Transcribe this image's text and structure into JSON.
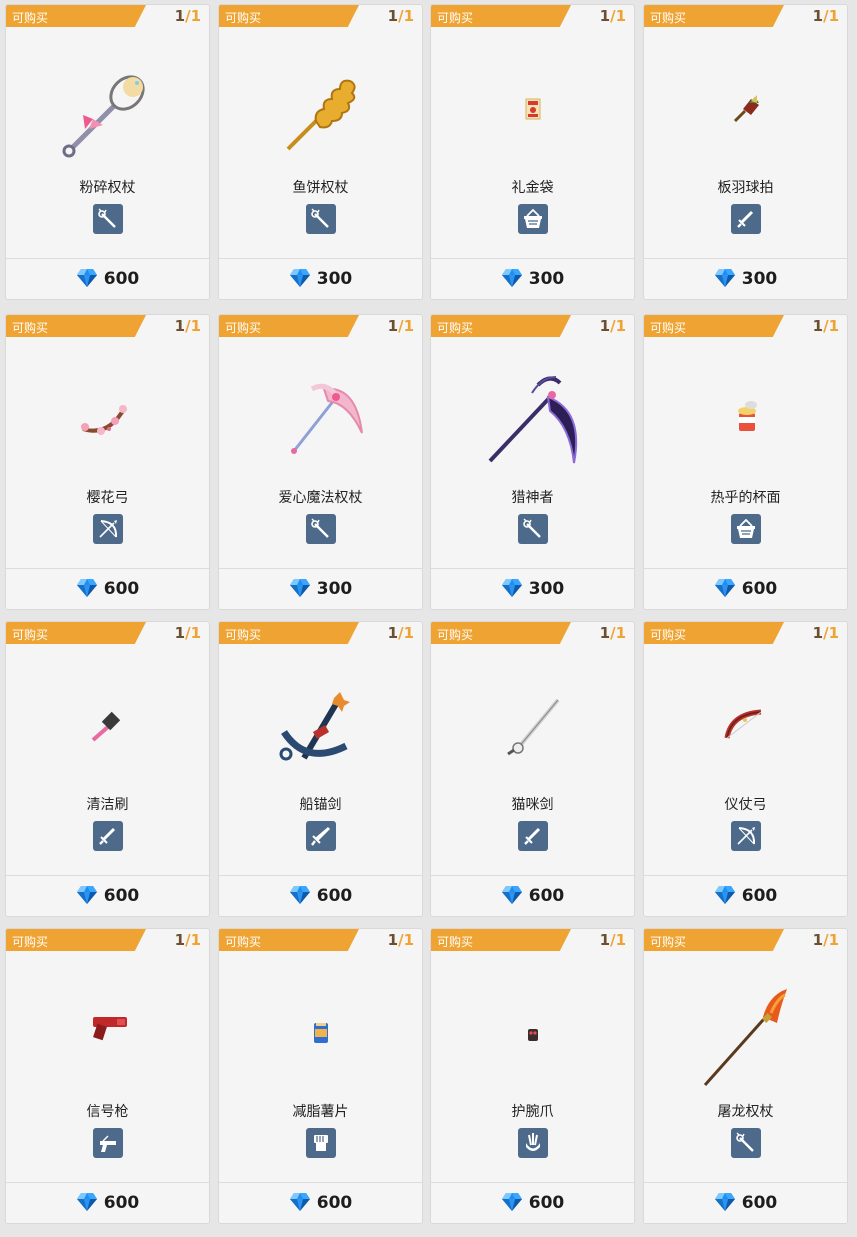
{
  "tag_label": "可购买",
  "stock": {
    "current": "1",
    "separator": "/",
    "max": "1"
  },
  "items": [
    {
      "name": "粉碎权杖",
      "type_icon": "staff-icon",
      "price": "600",
      "art": "whisk-staff"
    },
    {
      "name": "鱼饼权杖",
      "type_icon": "staff-icon",
      "price": "300",
      "art": "fishcake-staff"
    },
    {
      "name": "礼金袋",
      "type_icon": "basket-icon",
      "price": "300",
      "art": "red-envelope"
    },
    {
      "name": "板羽球拍",
      "type_icon": "sword-icon",
      "price": "300",
      "art": "paddle"
    },
    {
      "name": "樱花弓",
      "type_icon": "bow-icon",
      "price": "600",
      "art": "sakura-bow"
    },
    {
      "name": "爱心魔法权杖",
      "type_icon": "staff-icon",
      "price": "300",
      "art": "heart-scythe"
    },
    {
      "name": "猎神者",
      "type_icon": "staff-icon",
      "price": "300",
      "art": "dark-scythe"
    },
    {
      "name": "热乎的杯面",
      "type_icon": "basket-icon",
      "price": "600",
      "art": "cup-noodle"
    },
    {
      "name": "清洁刷",
      "type_icon": "sword-icon",
      "price": "600",
      "art": "brush"
    },
    {
      "name": "船锚剑",
      "type_icon": "greatsword-icon",
      "price": "600",
      "art": "anchor"
    },
    {
      "name": "猫咪剑",
      "type_icon": "sword-icon",
      "price": "600",
      "art": "cat-sword"
    },
    {
      "name": "仪仗弓",
      "type_icon": "bow-icon",
      "price": "600",
      "art": "ceremony-bow"
    },
    {
      "name": "信号枪",
      "type_icon": "gun-icon",
      "price": "600",
      "art": "flare-gun"
    },
    {
      "name": "减脂薯片",
      "type_icon": "fist-icon",
      "price": "600",
      "art": "chips"
    },
    {
      "name": "护腕爪",
      "type_icon": "claw-icon",
      "price": "600",
      "art": "claw"
    },
    {
      "name": "屠龙权杖",
      "type_icon": "staff-icon",
      "price": "600",
      "art": "dragon-spear"
    }
  ],
  "colors": {
    "tag": "#eea332",
    "type_icon_bg": "#4d6a8a",
    "gem": "#1e8ff0"
  }
}
